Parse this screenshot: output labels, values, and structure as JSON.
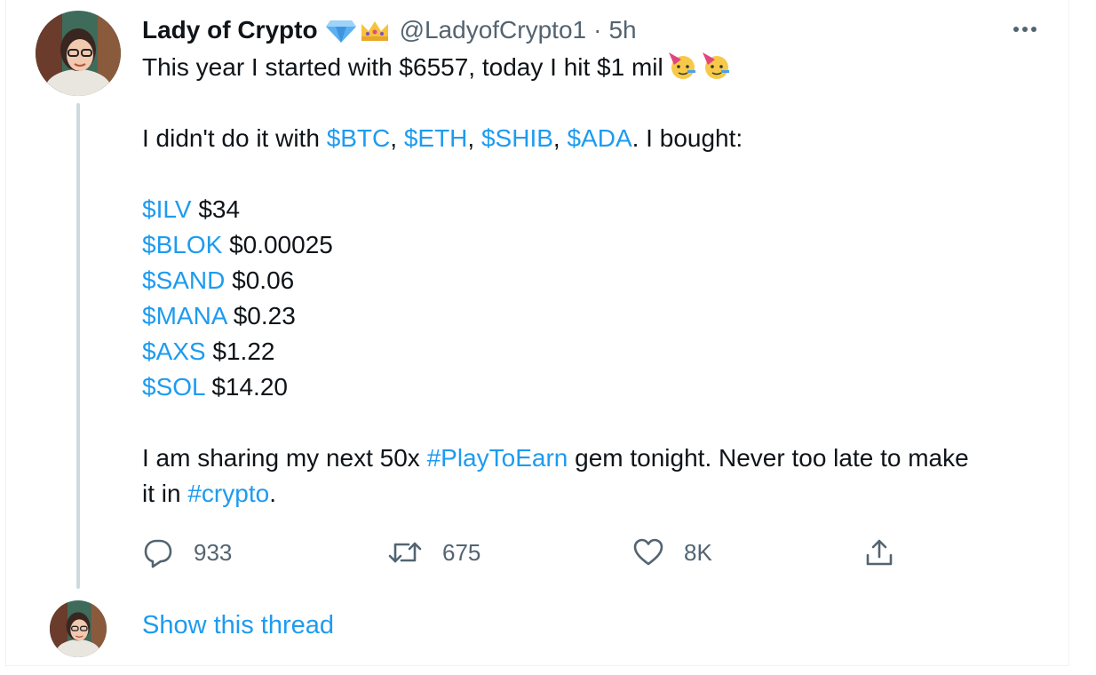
{
  "tweet": {
    "author_name": "Lady of Crypto",
    "badges": [
      "diamond-icon",
      "crown-icon"
    ],
    "handle": "@LadyofCrypto1",
    "separator": "·",
    "time": "5h",
    "line1": "This year I started with $6557, today I hit $1 mil",
    "line1_emojis": [
      "partying-face-icon",
      "partying-face-icon"
    ],
    "line2": {
      "prefix": "I didn't do it with ",
      "tickers": [
        "$BTC",
        "$ETH",
        "$SHIB",
        "$ADA"
      ],
      "comma": ",",
      "suffix": ". I bought:"
    },
    "holdings": [
      {
        "ticker": "$ILV",
        "price": "$34"
      },
      {
        "ticker": "$BLOK",
        "price": "$0.00025"
      },
      {
        "ticker": "$SAND",
        "price": "$0.06"
      },
      {
        "ticker": "$MANA",
        "price": "$0.23"
      },
      {
        "ticker": "$AXS",
        "price": "$1.22"
      },
      {
        "ticker": "$SOL",
        "price": "$14.20"
      }
    ],
    "closing": {
      "part1": "I am sharing my next 50x ",
      "hashtag1": "#PlayToEarn",
      "part2": " gem tonight. Never too late to make",
      "part3": "it in ",
      "hashtag2": "#crypto",
      "part4": "."
    }
  },
  "actions": {
    "replies": "933",
    "retweets": "675",
    "likes": "8K"
  },
  "thread": {
    "show_label": "Show this thread"
  },
  "colors": {
    "link": "#1d9bf0",
    "secondary_text": "#536471",
    "thread_line": "#cfd9de"
  }
}
